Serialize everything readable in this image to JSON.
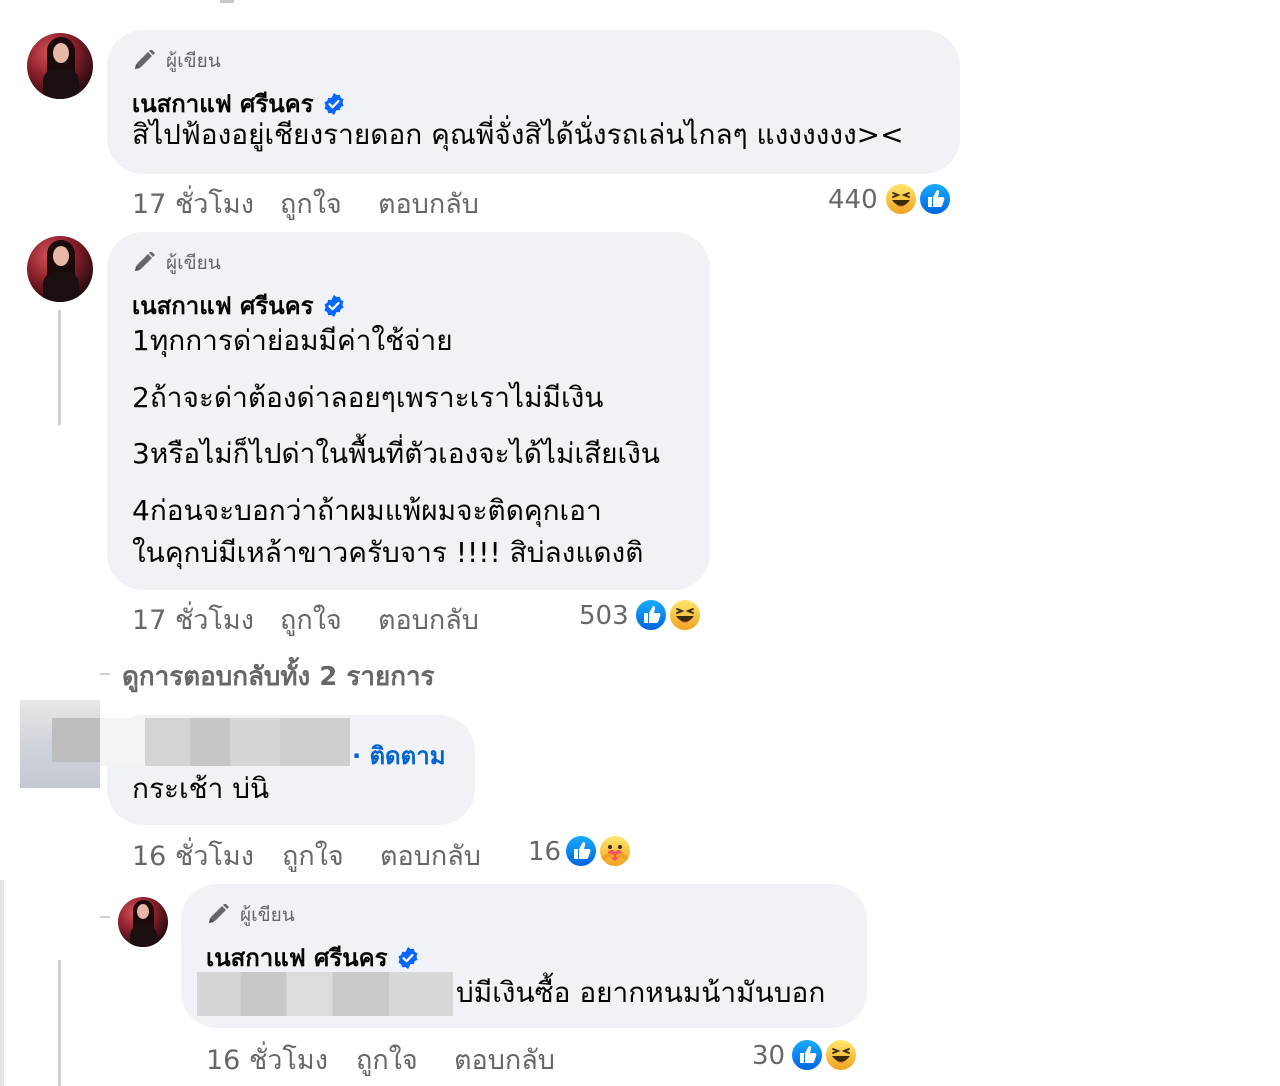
{
  "comments": [
    {
      "author_badge": "ผู้เขียน",
      "name": "เนสกาแฟ ศรีนคร",
      "lines": [
        "สิไปฟ้องอยู่เชียงรายดอก คุณพี่จั่งสิได้นั่งรถเล่นไกลๆ แงงงงงง><"
      ],
      "time": "17 ชั่วโมง",
      "like": "ถูกใจ",
      "reply": "ตอบกลับ",
      "reaction_count": "440",
      "reactions": [
        "haha-icon",
        "like-icon"
      ]
    },
    {
      "author_badge": "ผู้เขียน",
      "name": "เนสกาแฟ ศรีนคร",
      "lines": [
        "1ทุกการด่าย่อมมีค่าใช้จ่าย",
        "2ถ้าจะด่าต้องด่าลอยๆเพราะเราไม่มีเงิน",
        "3หรือไม่ก็ไปด่าในพื้นที่ตัวเองจะได้ไม่เสียเงิน",
        "4ก่อนจะบอกว่าถ้าผมแพ้ผมจะติดคุกเอา",
        "ในคุกบ่มีเหล้าขาวครับจาร !!!! สิบ่ลงแดงติ"
      ],
      "time": "17 ชั่วโมง",
      "like": "ถูกใจ",
      "reply": "ตอบกลับ",
      "reaction_count": "503",
      "reactions": [
        "like-icon",
        "haha-icon"
      ]
    }
  ],
  "view_replies": "ดูการตอบกลับทั้ง 2 รายการ",
  "reply_comment": {
    "follow": "· ติดตาม",
    "text": "กระเช้า บ่นิ",
    "time": "16 ชั่วโมง",
    "like": "ถูกใจ",
    "reply": "ตอบกลับ",
    "reaction_count": "16",
    "reactions": [
      "like-icon",
      "care-icon"
    ]
  },
  "author_reply": {
    "author_badge": "ผู้เขียน",
    "name": "เนสกาแฟ ศรีนคร",
    "text": "บ่มีเงินซื้อ อยากหนมน้ามันบอก",
    "time": "16 ชั่วโมง",
    "like": "ถูกใจ",
    "reply": "ตอบกลับ",
    "reaction_count": "30",
    "reactions": [
      "like-icon",
      "haha-icon"
    ]
  },
  "colors": {
    "bubble": "#f0f2f5",
    "meta_text": "#65676b",
    "like_blue": "#1877f2",
    "haha_yellow": "#f7b125",
    "follow_blue": "#0064d1"
  }
}
